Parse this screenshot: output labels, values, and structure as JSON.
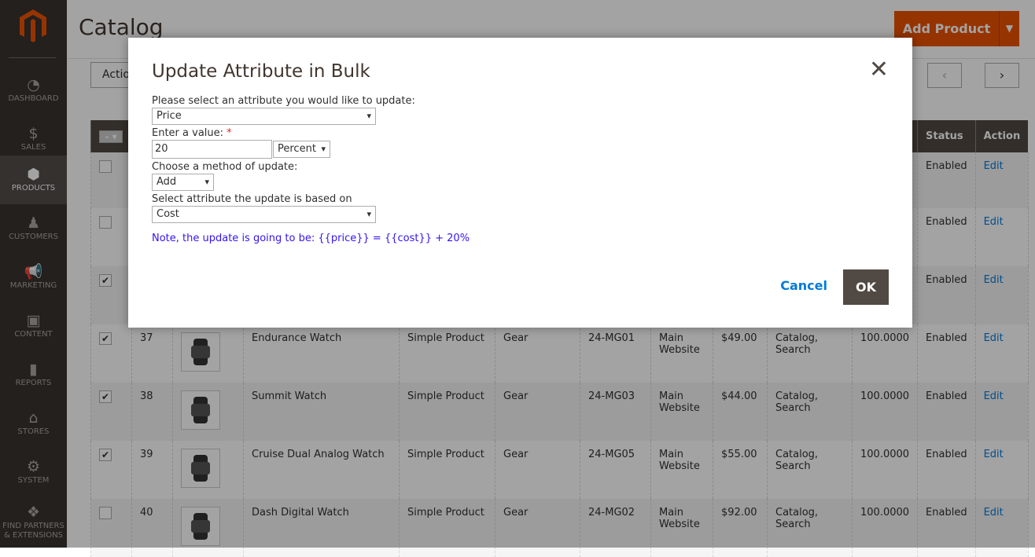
{
  "sidebar": {
    "items": [
      {
        "label": "DASHBOARD",
        "icon": "gauge-icon",
        "glyph": "◔"
      },
      {
        "label": "SALES",
        "icon": "dollar-icon",
        "glyph": "$"
      },
      {
        "label": "PRODUCTS",
        "icon": "box-icon",
        "glyph": "⬢",
        "active": true
      },
      {
        "label": "CUSTOMERS",
        "icon": "person-icon",
        "glyph": "♟"
      },
      {
        "label": "MARKETING",
        "icon": "megaphone-icon",
        "glyph": "📢"
      },
      {
        "label": "CONTENT",
        "icon": "layout-icon",
        "glyph": "▣"
      },
      {
        "label": "REPORTS",
        "icon": "bar-chart-icon",
        "glyph": "▮"
      },
      {
        "label": "STORES",
        "icon": "store-icon",
        "glyph": "⌂"
      },
      {
        "label": "SYSTEM",
        "icon": "gear-icon",
        "glyph": "⚙"
      },
      {
        "label": "FIND PARTNERS & EXTENSIONS",
        "icon": "cubes-icon",
        "glyph": "❖"
      }
    ]
  },
  "header": {
    "title": "Catalog",
    "add_product": "Add Product",
    "actions": "Actions"
  },
  "colors": {
    "accent": "#eb5202",
    "sidebar": "#373330",
    "link": "#007bdb",
    "note": "#3414f5"
  },
  "grid": {
    "columns": [
      "",
      "",
      "",
      "",
      "",
      "",
      "",
      "",
      "",
      "",
      "",
      "Status",
      "Action"
    ],
    "rows": [
      {
        "checked": false,
        "id": "",
        "name": "",
        "type": "",
        "set": "",
        "sku": "",
        "website": "",
        "price": "",
        "visibility": "",
        "qty": "",
        "status": "Enabled",
        "action": "Edit",
        "thumb": false
      },
      {
        "checked": false,
        "id": "",
        "name": "",
        "type": "",
        "set": "",
        "sku": "",
        "website": "",
        "price": "",
        "visibility": "",
        "qty": "",
        "status": "Enabled",
        "action": "Edit",
        "thumb": false
      },
      {
        "checked": true,
        "id": "",
        "name": "",
        "type": "",
        "set": "",
        "sku": "",
        "website": "",
        "price": "",
        "visibility": "",
        "qty": "",
        "status": "Enabled",
        "action": "Edit",
        "thumb": false
      },
      {
        "checked": true,
        "id": "37",
        "name": "Endurance Watch",
        "type": "Simple Product",
        "set": "Gear",
        "sku": "24-MG01",
        "website": "Main Website",
        "price": "$49.00",
        "visibility": "Catalog, Search",
        "qty": "100.0000",
        "status": "Enabled",
        "action": "Edit",
        "thumb": true
      },
      {
        "checked": true,
        "id": "38",
        "name": "Summit Watch",
        "type": "Simple Product",
        "set": "Gear",
        "sku": "24-MG03",
        "website": "Main Website",
        "price": "$44.00",
        "visibility": "Catalog, Search",
        "qty": "100.0000",
        "status": "Enabled",
        "action": "Edit",
        "thumb": true
      },
      {
        "checked": true,
        "id": "39",
        "name": "Cruise Dual Analog Watch",
        "type": "Simple Product",
        "set": "Gear",
        "sku": "24-MG05",
        "website": "Main Website",
        "price": "$55.00",
        "visibility": "Catalog, Search",
        "qty": "100.0000",
        "status": "Enabled",
        "action": "Edit",
        "thumb": true
      },
      {
        "checked": false,
        "id": "40",
        "name": "Dash Digital Watch",
        "type": "Simple Product",
        "set": "Gear",
        "sku": "24-MG02",
        "website": "Main Website",
        "price": "$92.00",
        "visibility": "Catalog, Search",
        "qty": "100.0000",
        "status": "Enabled",
        "action": "Edit",
        "thumb": true
      }
    ]
  },
  "modal": {
    "title": "Update Attribute in Bulk",
    "attr_label": "Please select an attribute you would like to update:",
    "attr_value": "Price",
    "value_label": "Enter a value:",
    "required": "*",
    "value": "20",
    "unit": "Percent",
    "method_label": "Choose a method of update:",
    "method": "Add",
    "based_label": "Select attribute the update is based on",
    "based": "Cost",
    "note": "Note, the update is going to be: {{price}} = {{cost}} + 20%",
    "cancel": "Cancel",
    "ok": "OK"
  }
}
